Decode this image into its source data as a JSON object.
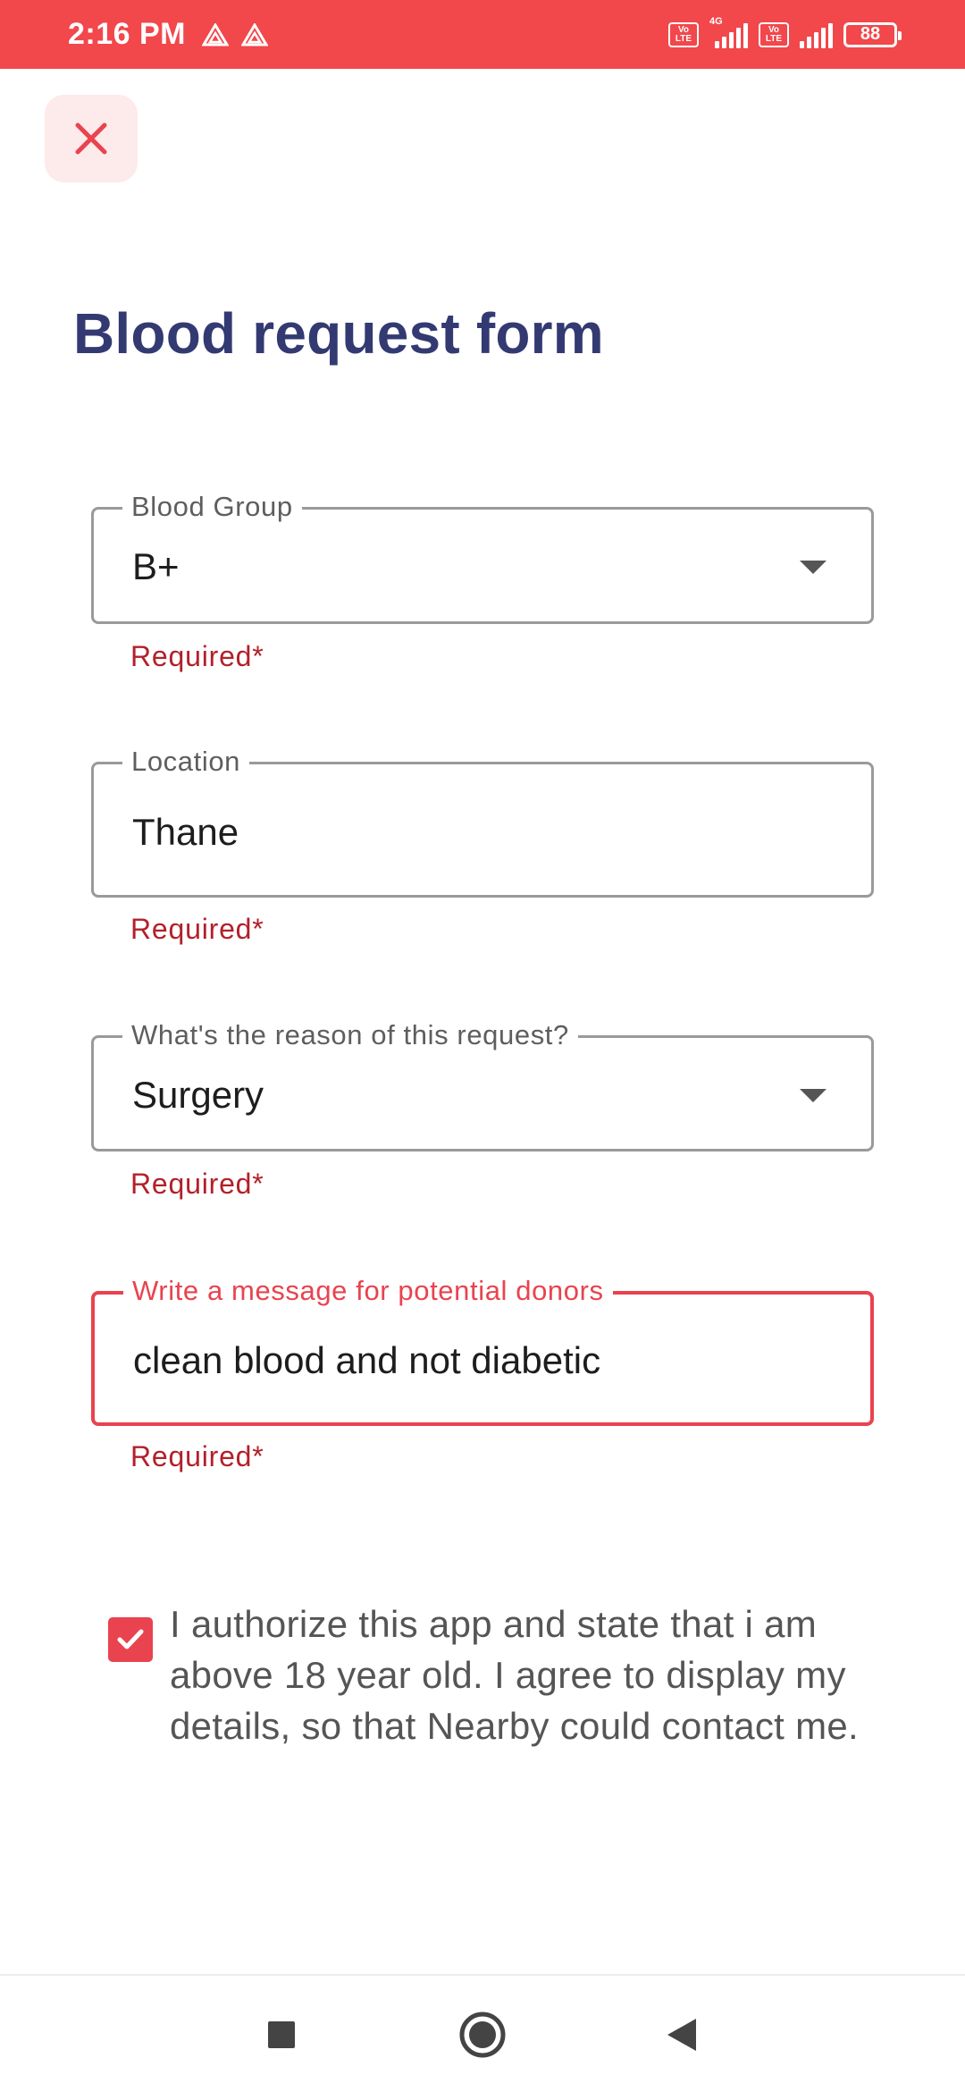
{
  "status_bar": {
    "time": "2:16 PM",
    "volte_label": "Vo LTE",
    "network_type": "4G",
    "battery": "88",
    "background": "#f2474b"
  },
  "header": {
    "close_icon": "close-icon",
    "title": "Blood request form"
  },
  "form": {
    "blood_group": {
      "label": "Blood Group",
      "value": "B+",
      "helper": "Required*"
    },
    "location": {
      "label": "Location",
      "value": "Thane",
      "helper": "Required*"
    },
    "reason": {
      "label": "What's the reason of this request?",
      "value": "Surgery",
      "helper": "Required*"
    },
    "message": {
      "label": "Write a message for potential donors",
      "value": "clean blood and not diabetic",
      "helper": "Required*"
    }
  },
  "consent": {
    "checked": true,
    "text": "I authorize this app and state that i am above 18 year old. I agree to display my details, so that Nearby could contact me."
  },
  "nav": {
    "recents_icon": "square-icon",
    "home_icon": "circle-icon",
    "back_icon": "triangle-back-icon"
  },
  "colors": {
    "accent": "#e9434f",
    "title": "#333a72",
    "error": "#b3202a"
  }
}
